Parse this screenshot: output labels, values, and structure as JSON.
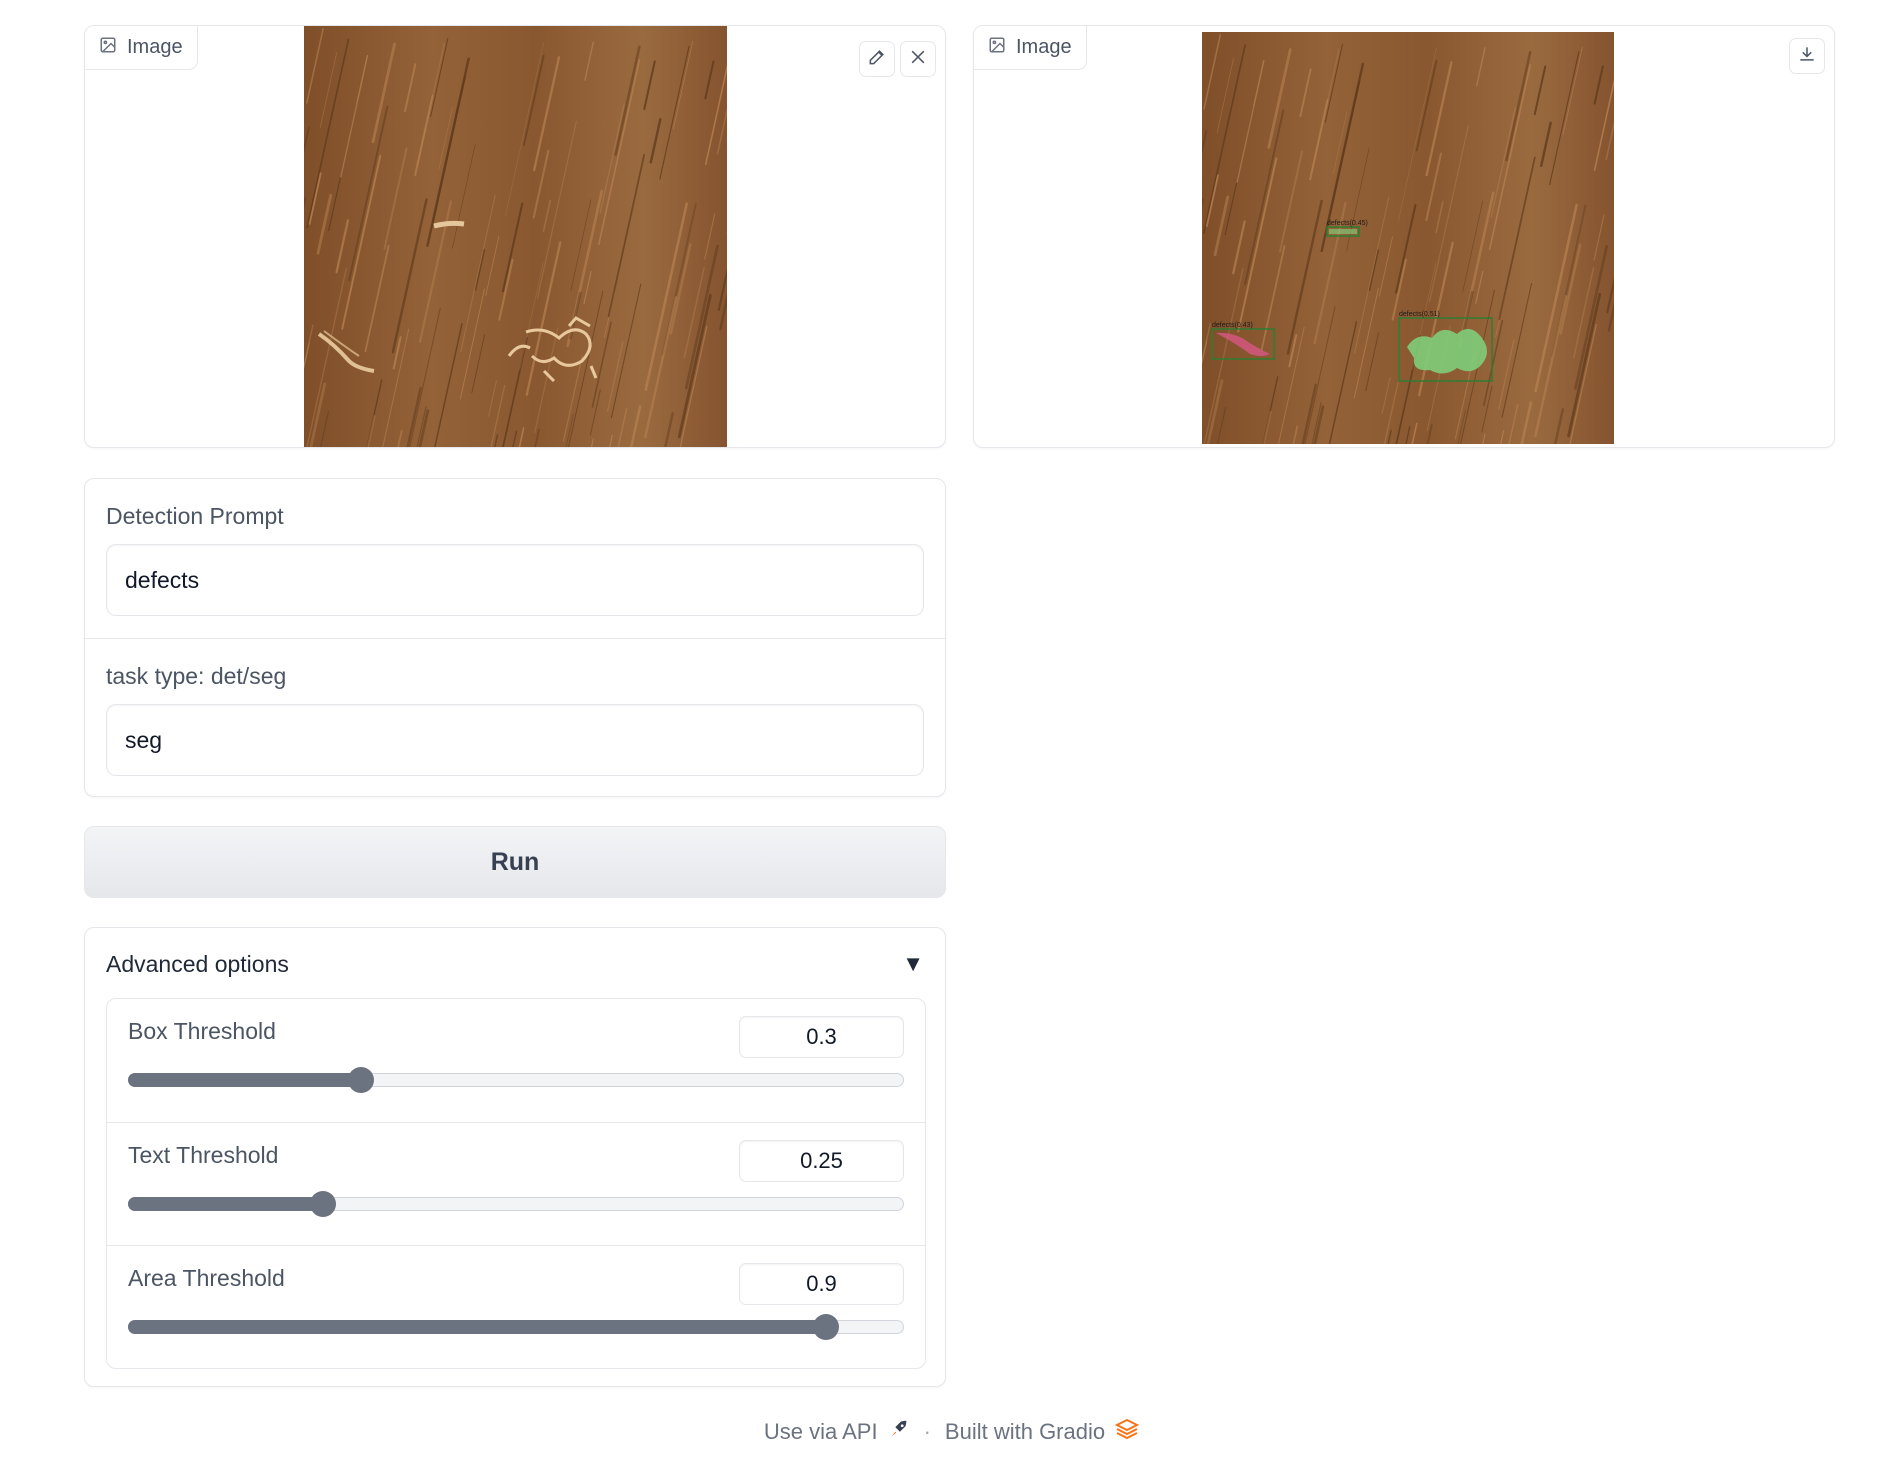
{
  "input_image": {
    "label": "Image",
    "icon": "image-icon",
    "actions": [
      "edit-icon",
      "close-icon"
    ]
  },
  "output_image": {
    "label": "Image",
    "icon": "image-icon",
    "actions": [
      "download-icon"
    ],
    "detections": [
      {
        "label": "defects(0.45)"
      },
      {
        "label": "defects(0.43)"
      },
      {
        "label": "defects(0.51)"
      }
    ]
  },
  "form": {
    "prompt_label": "Detection Prompt",
    "prompt_value": "defects",
    "task_label": "task type: det/seg",
    "task_value": "seg"
  },
  "run_label": "Run",
  "advanced": {
    "title": "Advanced options",
    "arrow": "▼",
    "sliders": [
      {
        "label": "Box Threshold",
        "value": "0.3",
        "fraction": 0.3
      },
      {
        "label": "Text Threshold",
        "value": "0.25",
        "fraction": 0.25
      },
      {
        "label": "Area Threshold",
        "value": "0.9",
        "fraction": 0.9
      }
    ]
  },
  "footer": {
    "api_label": "Use via API",
    "separator": "·",
    "built_label": "Built with Gradio"
  },
  "colors": {
    "wood": "#8a5a32",
    "detection_box": "#2e7d32",
    "mask_green": "#7ed37e",
    "mask_pink": "#d4577f",
    "gradio_orange": "#f97316"
  }
}
